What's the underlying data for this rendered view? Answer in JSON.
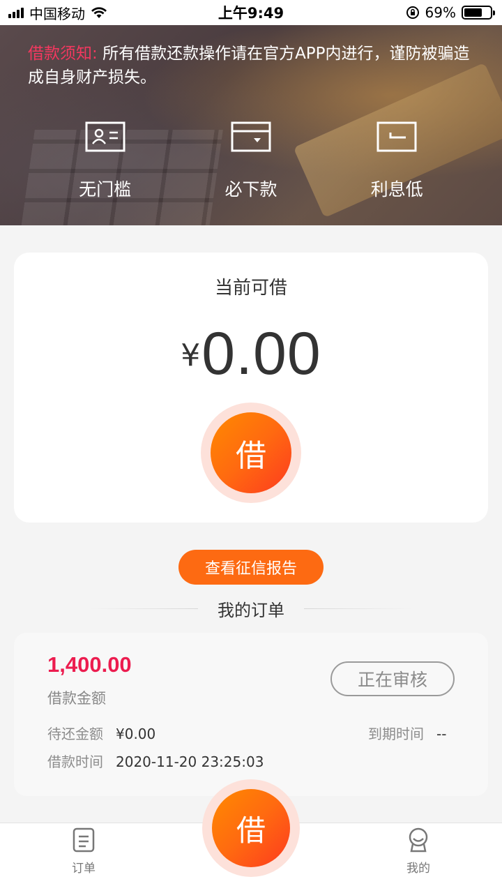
{
  "status_bar": {
    "carrier": "中国移动",
    "time": "上午9:49",
    "battery": "69%",
    "battery_level": 0.69
  },
  "banner": {
    "notice_label": "借款须知:",
    "notice_text": "所有借款还款操作请在官方APP内进行，谨防被骗造成自身财产损失。",
    "features": [
      {
        "label": "无门槛",
        "icon": "id-card-icon"
      },
      {
        "label": "必下款",
        "icon": "wallet-icon"
      },
      {
        "label": "利息低",
        "icon": "card-return-icon"
      }
    ]
  },
  "loan_card": {
    "title": "当前可借",
    "currency": "¥",
    "amount": "0.00",
    "borrow_label": "借"
  },
  "report_button": "查看征信报告",
  "orders_heading": "我的订单",
  "order": {
    "amount": "1,400.00",
    "amount_label": "借款金额",
    "status": "正在审核",
    "due_amount_label": "待还金额",
    "due_amount": "¥0.00",
    "due_time_label": "到期时间",
    "due_time": "--",
    "borrow_time_label": "借款时间",
    "borrow_time": "2020-11-20 23:25:03"
  },
  "bottom_nav": {
    "orders_label": "订单",
    "borrow_label": "借",
    "mine_label": "我的"
  },
  "colors": {
    "accent": "#fd6a12",
    "notice_red": "#f3385f",
    "amount_red": "#ec1c4f"
  }
}
